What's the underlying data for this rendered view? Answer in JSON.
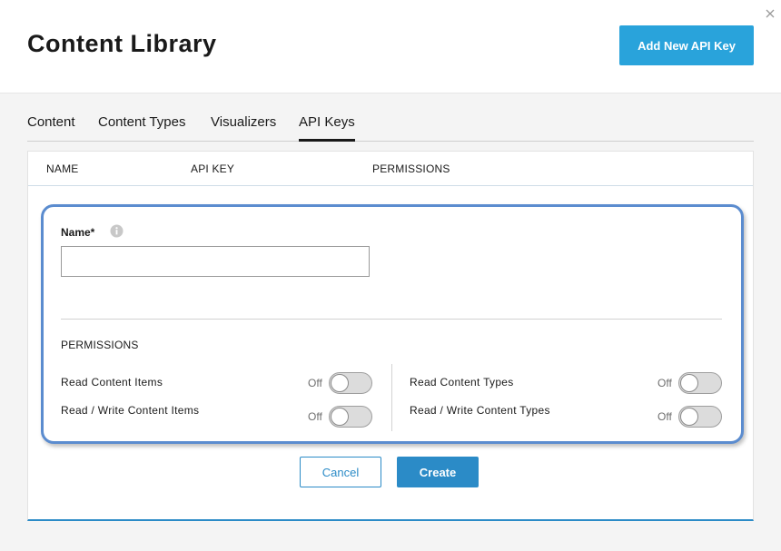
{
  "header": {
    "title": "Content Library",
    "add_button_label": "Add New API Key",
    "close_icon": "close-icon"
  },
  "tabs": [
    {
      "label": "Content",
      "active": false
    },
    {
      "label": "Content Types",
      "active": false
    },
    {
      "label": "Visualizers",
      "active": false
    },
    {
      "label": "API Keys",
      "active": true
    }
  ],
  "table": {
    "columns": [
      "NAME",
      "API KEY",
      "PERMISSIONS"
    ]
  },
  "form": {
    "name_label": "Name*",
    "name_value": "",
    "name_placeholder": "",
    "info_icon": "info-icon",
    "permissions_title": "PERMISSIONS",
    "permissions": [
      {
        "label": "Read Content Items",
        "state": "Off"
      },
      {
        "label": "Read / Write Content Items",
        "state": "Off"
      },
      {
        "label": "Read Content Types",
        "state": "Off"
      },
      {
        "label": "Read / Write Content Types",
        "state": "Off"
      }
    ],
    "cancel_label": "Cancel",
    "create_label": "Create"
  },
  "colors": {
    "accent": "#29a3db",
    "primary_button": "#2b8bc7",
    "focus_outline": "#5b8ccf"
  }
}
